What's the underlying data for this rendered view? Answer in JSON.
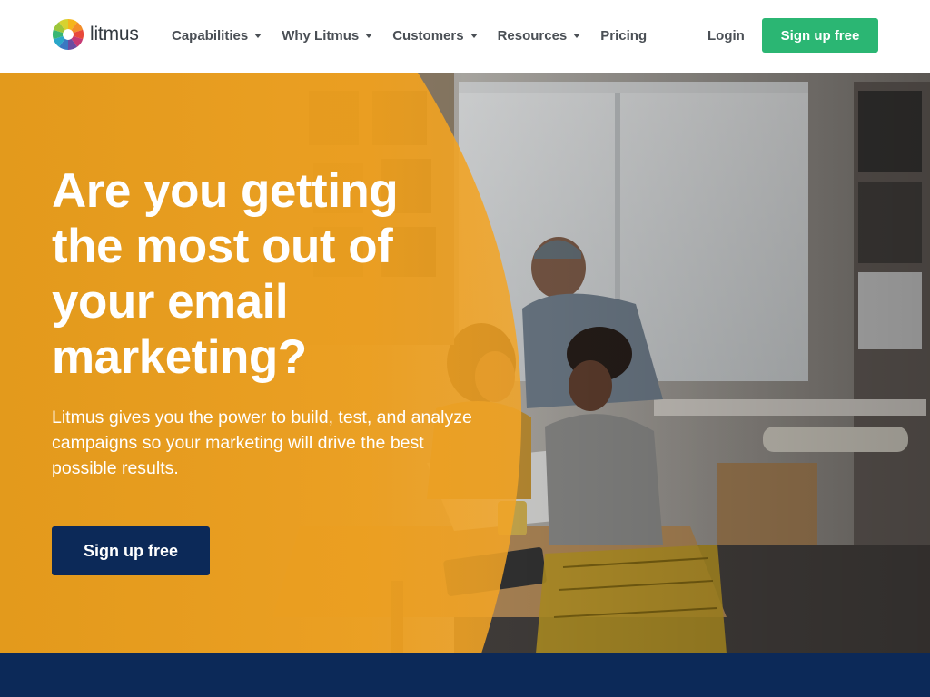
{
  "brand": {
    "name": "litmus",
    "logo_colors": [
      "#f5b51b",
      "#f38e2a",
      "#e8483a",
      "#c63a74",
      "#6b4ca2",
      "#3a78c2",
      "#2aa7c9",
      "#37b674",
      "#9cc63b",
      "#d7d230"
    ]
  },
  "nav": {
    "items": [
      {
        "label": "Capabilities",
        "has_dropdown": true
      },
      {
        "label": "Why Litmus",
        "has_dropdown": true
      },
      {
        "label": "Customers",
        "has_dropdown": true
      },
      {
        "label": "Resources",
        "has_dropdown": true
      },
      {
        "label": "Pricing",
        "has_dropdown": false
      }
    ],
    "login_label": "Login",
    "signup_label": "Sign up free"
  },
  "hero": {
    "title": "Are you getting the most out of your email marketing?",
    "subtitle": "Litmus gives you the power to build, test, and analyze campaigns so your marketing will drive the best possible results.",
    "cta_label": "Sign up free"
  },
  "colors": {
    "accent_green": "#2bb673",
    "navy": "#0c2958",
    "hero_orange": "#e9a020",
    "nav_text": "#4a4f55"
  }
}
